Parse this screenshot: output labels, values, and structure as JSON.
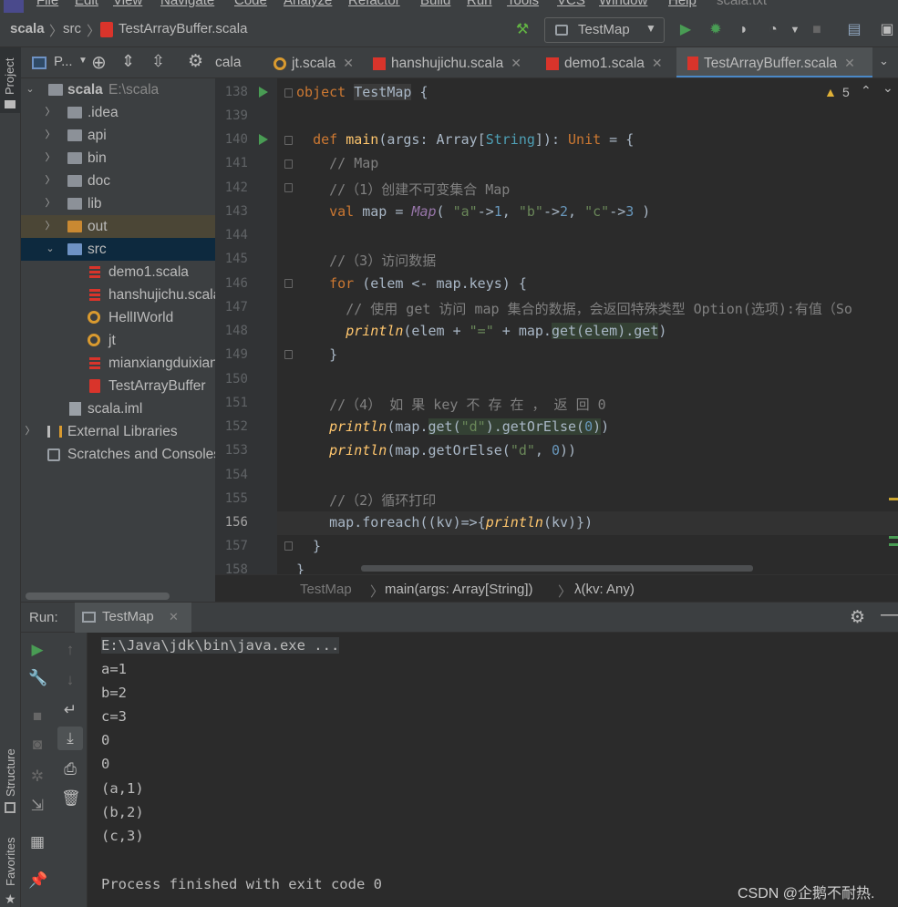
{
  "menu": {
    "items": [
      "File",
      "Edit",
      "View",
      "Navigate",
      "Code",
      "Analyze",
      "Refactor",
      "Build",
      "Run",
      "Tools",
      "VCS",
      "Window",
      "Help"
    ],
    "extra": "scala.txt"
  },
  "nav": {
    "project": "scala",
    "folder": "src",
    "file": "TestArrayBuffer.scala",
    "run_config": "TestMap"
  },
  "side": {
    "project_label": "Project",
    "structure_label": "Structure",
    "favorites_label": "Favorites"
  },
  "project_view": {
    "title": "P..."
  },
  "tree": {
    "root_name": "scala",
    "root_path": "E:\\scala",
    "items": [
      ".idea",
      "api",
      "bin",
      "doc",
      "lib",
      "out",
      "src",
      "demo1.scala",
      "hanshujichu.scala",
      "HellIWorld",
      "jt",
      "mianxiangduixiang",
      "TestArrayBuffer",
      "scala.iml",
      "External Libraries",
      "Scratches and Consoles"
    ]
  },
  "tabs": [
    {
      "label": "cala"
    },
    {
      "label": "jt.scala"
    },
    {
      "label": "hanshujichu.scala"
    },
    {
      "label": "demo1.scala"
    },
    {
      "label": "TestArrayBuffer.scala"
    }
  ],
  "editor": {
    "warnings": "5",
    "line_numbers": [
      "138",
      "139",
      "140",
      "141",
      "142",
      "143",
      "144",
      "145",
      "146",
      "147",
      "148",
      "149",
      "150",
      "151",
      "152",
      "153",
      "154",
      "155",
      "156",
      "157",
      "158"
    ]
  },
  "breadcrumbs": {
    "obj": "TestMap",
    "method": "main(args: Array[String])",
    "lambda": "λ(kv: Any)"
  },
  "run": {
    "label": "Run:",
    "tab": "TestMap"
  },
  "console": {
    "lines": [
      "E:\\Java\\jdk\\bin\\java.exe ...",
      "a=1",
      "b=2",
      "c=3",
      "0",
      "0",
      "(a,1)",
      "(b,2)",
      "(c,3)",
      "",
      "Process finished with exit code 0"
    ]
  },
  "watermark": "CSDN @企鹅不耐热.",
  "colors": {
    "keyword": "#cc7832",
    "string": "#6a8759",
    "number": "#6897bb",
    "comment": "#808080",
    "function": "#ffc66d",
    "accent": "#4a88c7",
    "run": "#499c54"
  }
}
